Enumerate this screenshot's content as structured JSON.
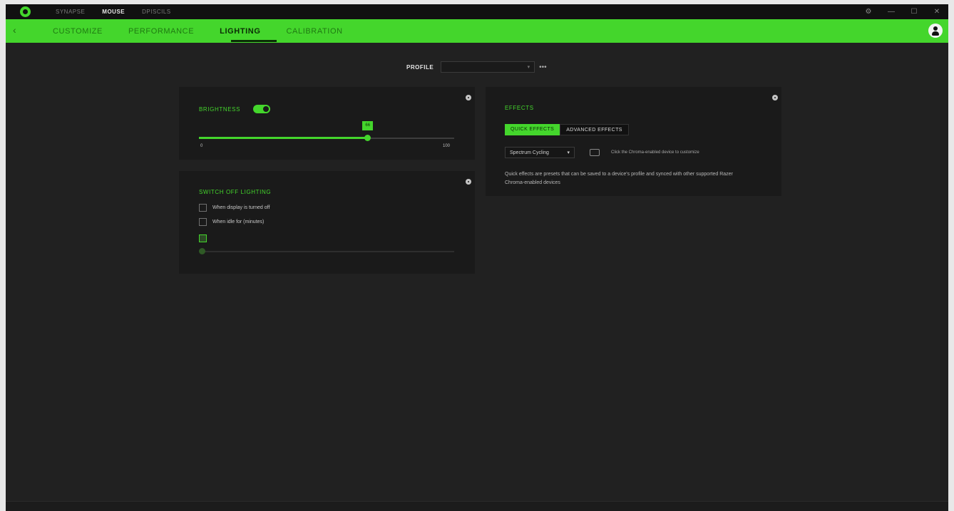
{
  "topnav": {
    "items": [
      {
        "label": "SYNAPSE",
        "active": false
      },
      {
        "label": "MOUSE",
        "active": true
      },
      {
        "label": "DPISCILS",
        "active": false
      }
    ]
  },
  "window_controls": {
    "settings": "⚙",
    "minimize": "—",
    "maximize": "☐",
    "close": "✕"
  },
  "tabbar": {
    "back": "‹",
    "tabs": [
      {
        "label": "CUSTOMIZE",
        "active": false
      },
      {
        "label": "PERFORMANCE",
        "active": false
      },
      {
        "label": "LIGHTING",
        "active": true
      },
      {
        "label": "CALIBRATION",
        "active": false
      }
    ]
  },
  "profile": {
    "label": "PROFILE",
    "value": "",
    "more": "•••"
  },
  "brightness": {
    "title": "BRIGHTNESS",
    "enabled": true,
    "value": 66,
    "min_label": "0",
    "max_label": "100",
    "value_fraction": 0.66
  },
  "switch_off": {
    "title": "SWITCH OFF LIGHTING",
    "options": [
      {
        "label": "When display is turned off",
        "checked": false
      },
      {
        "label": "When idle for (minutes)",
        "checked": false
      }
    ],
    "idle_value_fraction": 0.0
  },
  "effects": {
    "title": "EFFECTS",
    "modes": [
      {
        "label": "QUICK EFFECTS",
        "active": true
      },
      {
        "label": "ADVANCED EFFECTS",
        "active": false
      }
    ],
    "selected_effect": "Spectrum Cycling",
    "hint": "Click the Chroma-enabled device to customize",
    "description": "Quick effects are presets that can be saved to a device's profile and synced with other supported Razer Chroma-enabled devices"
  },
  "statusbar": {
    "text": ""
  },
  "colors": {
    "accent": "#44d62c",
    "background": "#212121",
    "panel": "#1a1a1a"
  },
  "icons": {
    "logo": "razer-logo-icon",
    "settings": "gear-icon",
    "user": "user-avatar-icon",
    "device": "device-icon"
  }
}
